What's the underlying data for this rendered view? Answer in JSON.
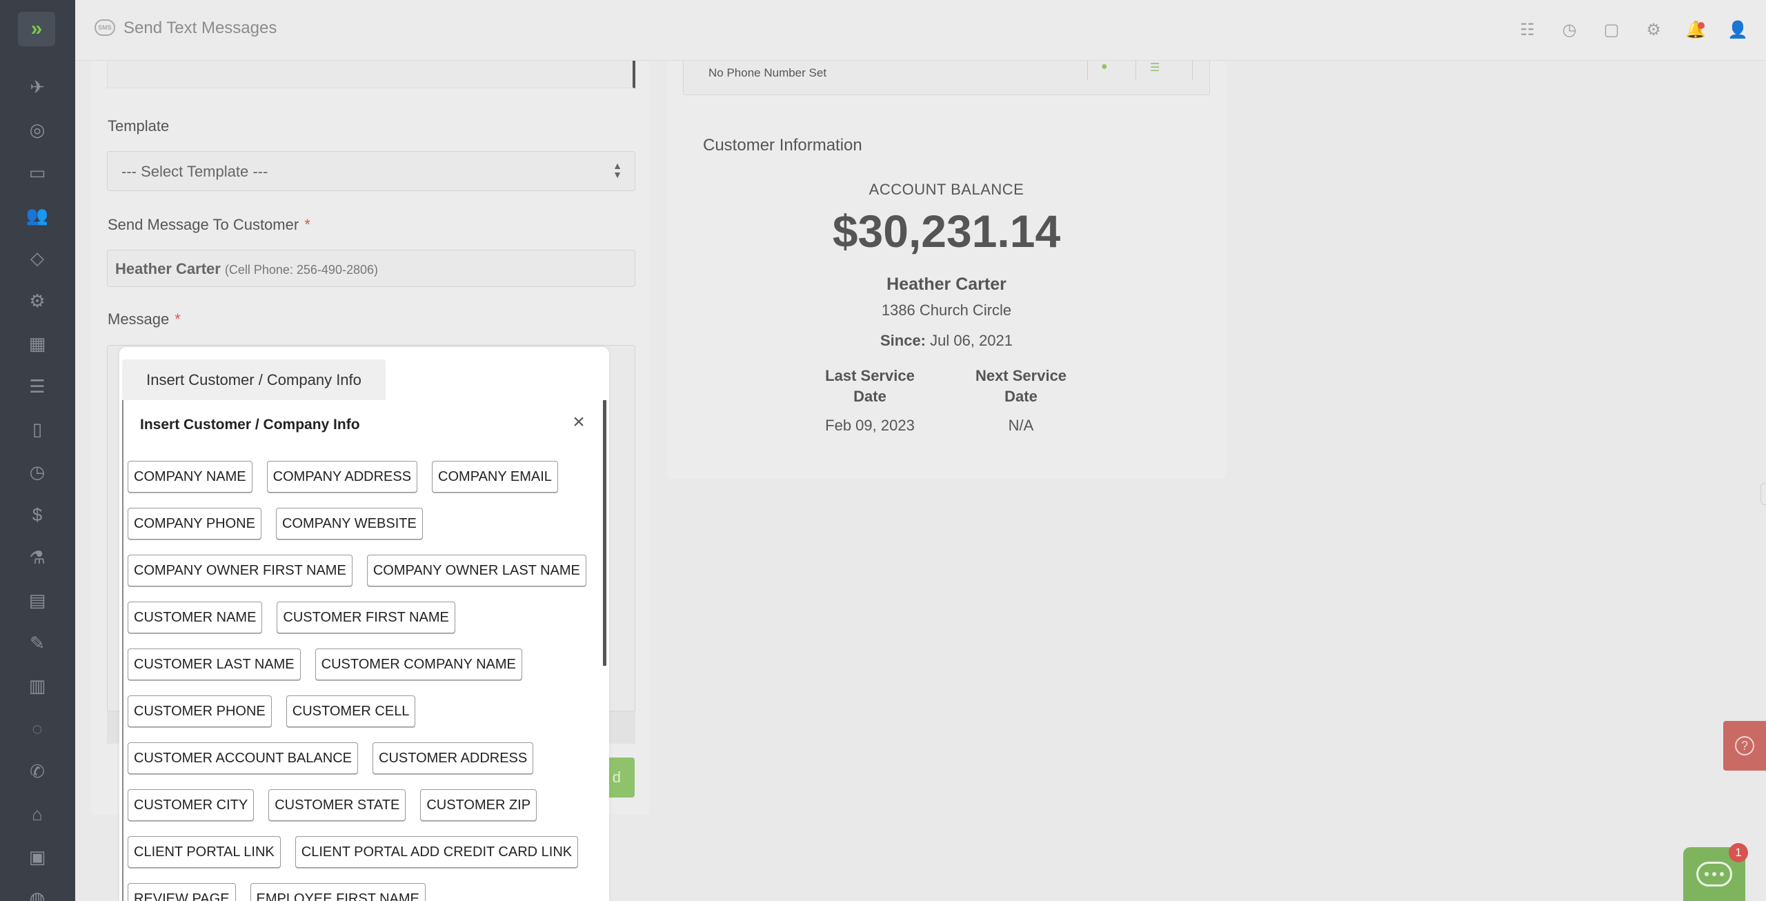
{
  "header": {
    "sms_label": "SMS",
    "title": "Send Text Messages"
  },
  "form": {
    "template_label": "Template",
    "template_value": "--- Select Template ---",
    "send_to_label": "Send Message To Customer",
    "required_mark": "*",
    "customer_name": "Heather Carter",
    "customer_phone": "(Cell Phone: 256-490-2806)",
    "message_label": "Message",
    "send_label": "d"
  },
  "customer_info": {
    "phone_status": "No Phone Number Set",
    "title": "Customer Information",
    "account_balance_label": "ACCOUNT BALANCE",
    "account_balance": "$30,231.14",
    "name": "Heather Carter",
    "address": "1386 Church Circle",
    "since_label": "Since:",
    "since_value": "Jul 06, 2021",
    "last_service_label_1": "Last Service",
    "last_service_label_2": "Date",
    "last_service_value": "Feb 09, 2023",
    "next_service_label_1": "Next Service",
    "next_service_label_2": "Date",
    "next_service_value": "N/A"
  },
  "popover": {
    "tab_label": "Insert Customer / Company Info",
    "title": "Insert Customer / Company Info",
    "rows": [
      [
        "COMPANY NAME",
        "COMPANY ADDRESS",
        "COMPANY EMAIL"
      ],
      [
        "COMPANY PHONE",
        "COMPANY WEBSITE"
      ],
      [
        "COMPANY OWNER FIRST NAME",
        "COMPANY OWNER LAST NAME"
      ],
      [
        "CUSTOMER NAME",
        "CUSTOMER FIRST NAME"
      ],
      [
        "CUSTOMER LAST NAME",
        "CUSTOMER COMPANY NAME"
      ],
      [
        "CUSTOMER PHONE",
        "CUSTOMER CELL"
      ],
      [
        "CUSTOMER ACCOUNT BALANCE",
        "CUSTOMER ADDRESS"
      ],
      [
        "CUSTOMER CITY",
        "CUSTOMER STATE",
        "CUSTOMER ZIP"
      ],
      [
        "CLIENT PORTAL LINK",
        "CLIENT PORTAL ADD CREDIT CARD LINK"
      ],
      [
        "REVIEW PAGE",
        "EMPLOYEE FIRST NAME"
      ]
    ]
  },
  "chat": {
    "badge_count": "1"
  },
  "colors": {
    "sidebar_bg": "#3a3f48",
    "accent_green": "#8fc36b",
    "alert_red": "#d9534f"
  }
}
